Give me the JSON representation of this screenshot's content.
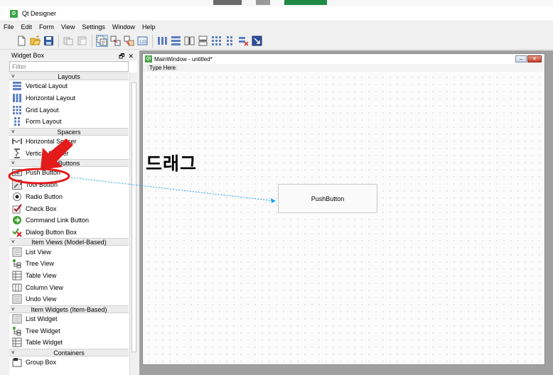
{
  "window": {
    "title": "Qt Designer",
    "app_icon": "qt-designer-app-icon"
  },
  "menubar": [
    "File",
    "Edit",
    "Form",
    "View",
    "Settings",
    "Window",
    "Help"
  ],
  "toolbar": {
    "icons": [
      "new-file-icon",
      "open-folder-icon",
      "save-icon",
      "copy-icon",
      "paste-icon",
      "edit-widgets-icon",
      "edit-signals-slots-icon",
      "edit-buddies-icon",
      "edit-tab-order-icon",
      "lay-out-horizontally-icon",
      "lay-out-vertically-icon",
      "lay-out-horizontal-splitter-icon",
      "lay-out-vertical-splitter-icon",
      "lay-out-grid-icon",
      "lay-out-form-icon",
      "break-layout-icon",
      "adjust-size-icon"
    ]
  },
  "widget_box": {
    "title": "Widget Box",
    "header_buttons": "ก  ×",
    "filter_placeholder": "Filter",
    "sections": [
      {
        "label": "Layouts",
        "items": [
          "Vertical Layout",
          "Horizontal Layout",
          "Grid Layout",
          "Form Layout"
        ]
      },
      {
        "label": "Spacers",
        "items": [
          "Horizontal Spacer",
          "Vertical Spacer"
        ]
      },
      {
        "label": "Buttons",
        "items": [
          "Push Button",
          "Tool Button",
          "Radio Button",
          "Check Box",
          "Command Link Button",
          "Dialog Button Box"
        ]
      },
      {
        "label": "Item Views (Model-Based)",
        "items": [
          "List View",
          "Tree View",
          "Table View",
          "Column View",
          "Undo View"
        ]
      },
      {
        "label": "Item Widgets (Item-Based)",
        "items": [
          "List Widget",
          "Tree Widget",
          "Table Widget"
        ]
      },
      {
        "label": "Containers",
        "items": [
          "Group Box"
        ]
      }
    ]
  },
  "form_window": {
    "title": "MainWindow - untitled*",
    "menu_placeholder": "Type Here",
    "push_button_label": "PushButton"
  },
  "annotation": {
    "text": "드래그",
    "color": "#e31b1b",
    "drag_line_color": "#1aa3e8"
  }
}
